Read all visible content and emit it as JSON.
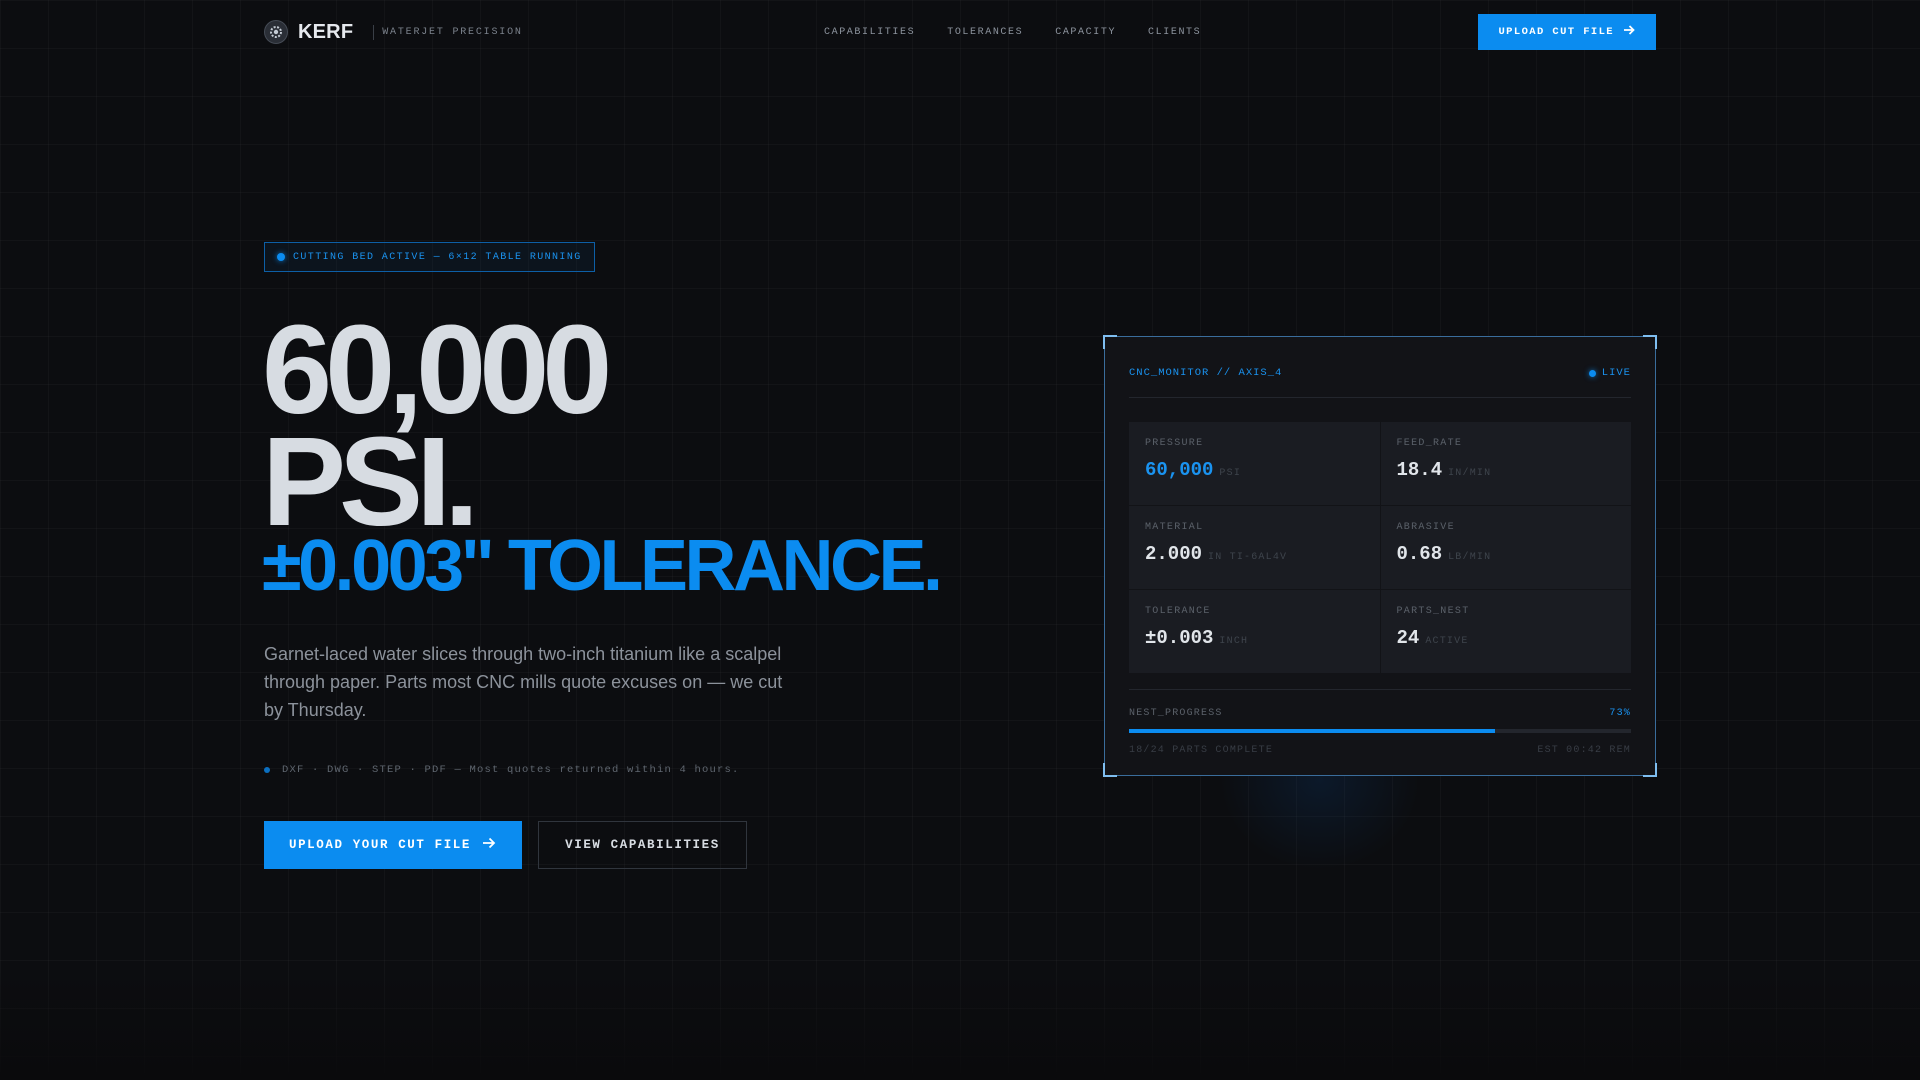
{
  "nav": {
    "brand": "KERF",
    "tagline": "WATERJET PRECISION",
    "links": [
      "CAPABILITIES",
      "TOLERANCES",
      "CAPACITY",
      "CLIENTS"
    ],
    "cta": "UPLOAD CUT FILE"
  },
  "hero": {
    "status": "CUTTING BED ACTIVE — 6×12 TABLE RUNNING",
    "line1": "60,000",
    "line2": "PSI.",
    "line3": "±0.003\" TOLERANCE.",
    "description": "Garnet-laced water slices through two-inch titanium like a scalpel through paper. Parts most CNC mills quote excuses on — we cut by Thursday.",
    "formats": "DXF · DWG · STEP · PDF — Most quotes returned within 4 hours.",
    "primary_button": "UPLOAD YOUR CUT FILE",
    "secondary_button": "VIEW CAPABILITIES"
  },
  "panel": {
    "title": "CNC_MONITOR // AXIS_4",
    "live": "LIVE",
    "metrics": [
      {
        "label": "PRESSURE",
        "value": "60,000",
        "unit": "PSI",
        "highlight": true
      },
      {
        "label": "FEED_RATE",
        "value": "18.4",
        "unit": "IN/MIN",
        "highlight": false
      },
      {
        "label": "MATERIAL",
        "value": "2.000",
        "unit": "IN TI-6AL4V",
        "highlight": false
      },
      {
        "label": "ABRASIVE",
        "value": "0.68",
        "unit": "LB/MIN",
        "highlight": false
      },
      {
        "label": "TOLERANCE",
        "value": "±0.003",
        "unit": "INCH",
        "highlight": false
      },
      {
        "label": "PARTS_NEST",
        "value": "24",
        "unit": "ACTIVE",
        "highlight": false
      }
    ],
    "progress": {
      "label": "NEST_PROGRESS",
      "percent_text": "73%",
      "fraction": 0.73,
      "complete_text": "18/24 PARTS COMPLETE",
      "eta": "EST 00:42 REM"
    }
  },
  "colors": {
    "accent": "#0b8cf0",
    "background": "#0c0d10",
    "headline": "#d7dce2"
  },
  "icons": {
    "logo": "gear-icon",
    "cta_arrow": "arrow-right-icon",
    "status_dot": "status-dot-icon"
  }
}
